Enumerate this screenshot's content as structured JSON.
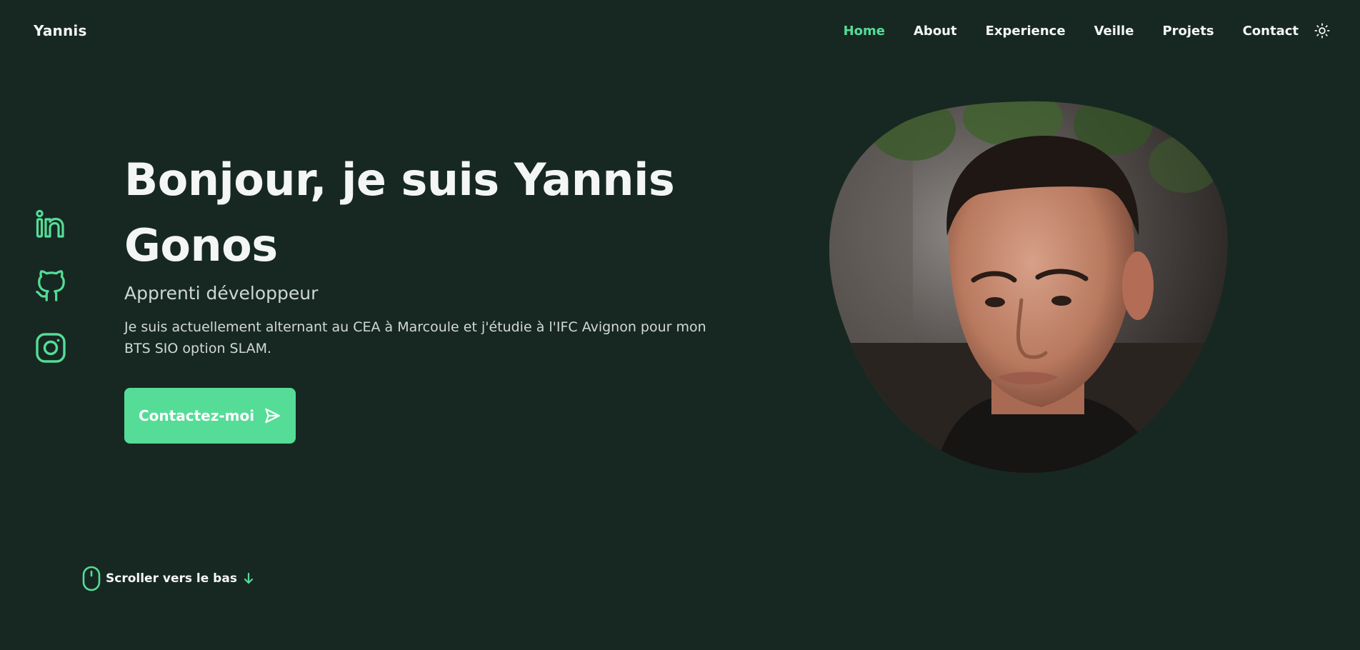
{
  "header": {
    "logo": "Yannis",
    "nav": [
      {
        "label": "Home",
        "active": true
      },
      {
        "label": "About"
      },
      {
        "label": "Experience"
      },
      {
        "label": "Veille"
      },
      {
        "label": "Projets"
      },
      {
        "label": "Contact"
      }
    ],
    "theme_icon": "sun-icon"
  },
  "socials": [
    "linkedin-icon",
    "github-icon",
    "instagram-icon"
  ],
  "hero": {
    "title": "Bonjour, je suis Yannis Gonos",
    "subtitle": "Apprenti développeur",
    "description": "Je suis actuellement alternant au CEA à Marcoule et j'étudie à l'IFC Avignon pour mon BTS SIO option SLAM.",
    "cta_label": "Contactez-moi",
    "cta_icon": "send-icon"
  },
  "scroll": {
    "label": "Scroller vers le bas",
    "mouse_icon": "mouse-icon",
    "arrow_icon": "arrow-down-icon"
  },
  "colors": {
    "background": "#172822",
    "accent": "#55dc97",
    "text": "#f4f6f5"
  }
}
